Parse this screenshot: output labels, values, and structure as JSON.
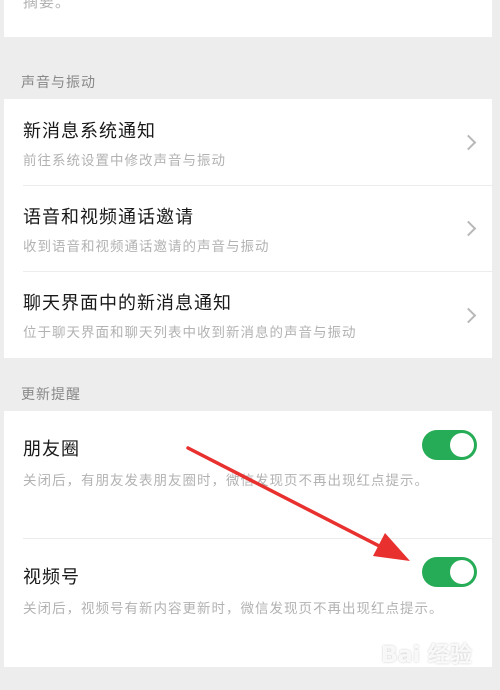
{
  "top_fragment": "摘要。",
  "sound_section": {
    "title": "声音与振动",
    "items": [
      {
        "title": "新消息系统通知",
        "desc": "前往系统设置中修改声音与振动"
      },
      {
        "title": "语音和视频通话邀请",
        "desc": "收到语音和视频通话邀请的声音与振动"
      },
      {
        "title": "聊天界面中的新消息通知",
        "desc": "位于聊天界面和聊天列表中收到新消息的声音与振动"
      }
    ]
  },
  "update_section": {
    "title": "更新提醒",
    "items": [
      {
        "title": "朋友圈",
        "desc": "关闭后，有朋友发表朋友圈时，微信发现页不再出现红点提示。",
        "enabled": true
      },
      {
        "title": "视频号",
        "desc": "关闭后，视频号有新内容更新时，微信发现页不再出现红点提示。",
        "enabled": true
      }
    ]
  },
  "colors": {
    "toggle_on": "#26ac56",
    "arrow": "#e8312f",
    "background": "#ededed"
  },
  "watermark": "Bai 经验"
}
